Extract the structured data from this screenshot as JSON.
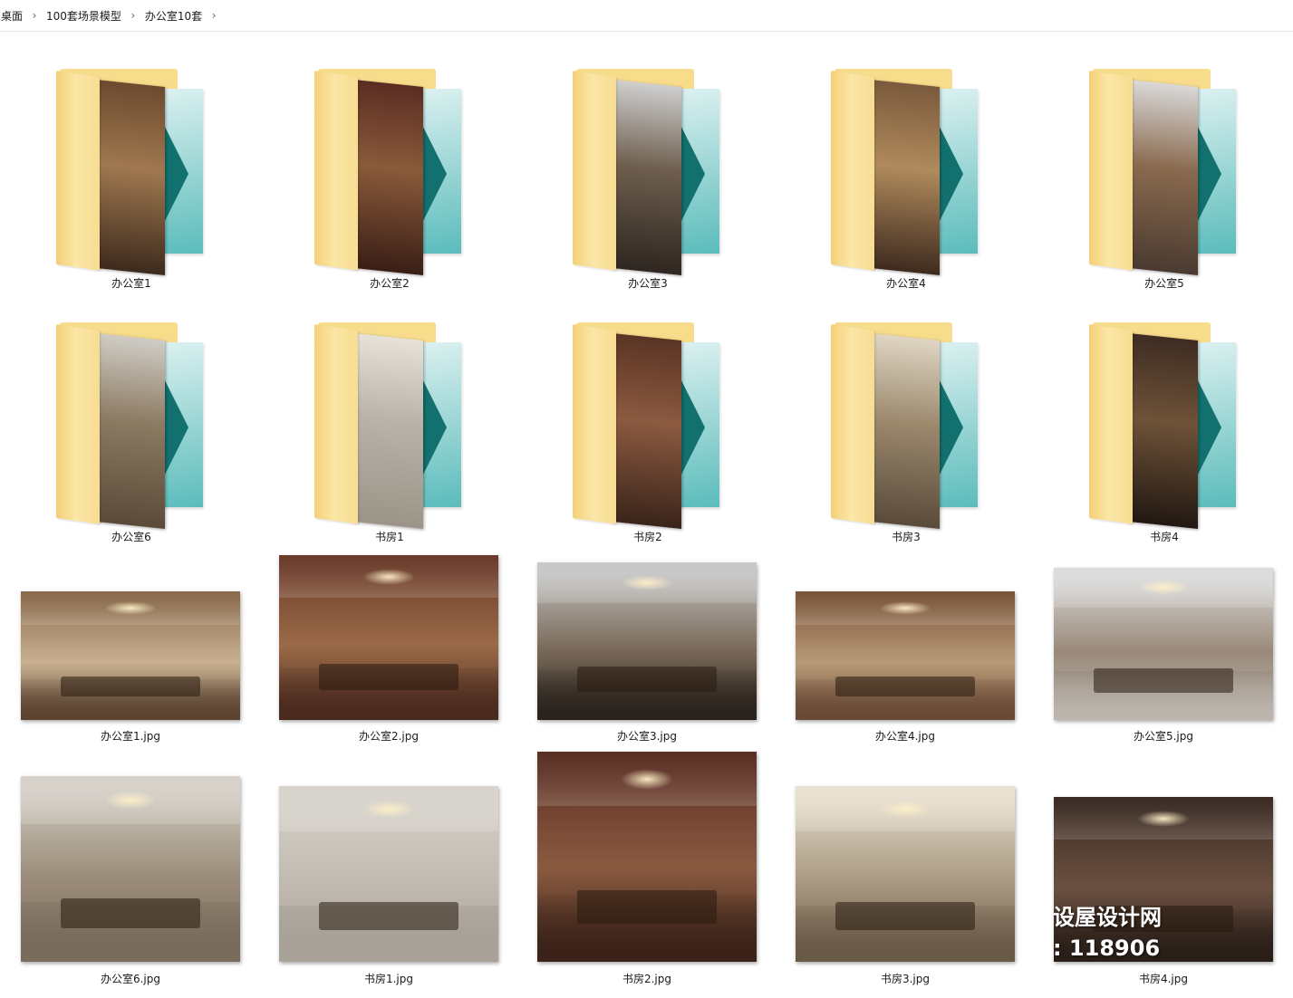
{
  "breadcrumb": {
    "items": [
      "桌面",
      "100套场景模型",
      "办公室10套"
    ]
  },
  "folders": [
    {
      "name": "办公室1",
      "palette": [
        "#6b4a2e",
        "#a07850",
        "#3d2a1c"
      ]
    },
    {
      "name": "办公室2",
      "palette": [
        "#5a2d22",
        "#8a5a3a",
        "#3a1e16"
      ]
    },
    {
      "name": "办公室3",
      "palette": [
        "#cfcfcf",
        "#6e5e4e",
        "#2e2620"
      ]
    },
    {
      "name": "办公室4",
      "palette": [
        "#7a5a3c",
        "#b08a5c",
        "#3e2a1e"
      ]
    },
    {
      "name": "办公室5",
      "palette": [
        "#d9d9d9",
        "#8a6a4e",
        "#4a3a30"
      ]
    },
    {
      "name": "办公室6",
      "palette": [
        "#d0cdc6",
        "#8c7a62",
        "#5a4a38"
      ]
    },
    {
      "name": "书房1",
      "palette": [
        "#e6e2da",
        "#b8b2a8",
        "#9c9488"
      ]
    },
    {
      "name": "书房2",
      "palette": [
        "#5a3424",
        "#8c5a40",
        "#3a241a"
      ]
    },
    {
      "name": "书房3",
      "palette": [
        "#e0d6c4",
        "#9c8a6e",
        "#5a4a3a"
      ]
    },
    {
      "name": "书房4",
      "palette": [
        "#3e2c22",
        "#6e5238",
        "#221812"
      ]
    }
  ],
  "images": [
    {
      "name": "办公室1.jpg",
      "palette": [
        "#8a6a4a",
        "#c8b090",
        "#5c4430"
      ]
    },
    {
      "name": "办公室2.jpg",
      "palette": [
        "#6a3a28",
        "#9a6a48",
        "#4a2a1e"
      ]
    },
    {
      "name": "办公室3.jpg",
      "palette": [
        "#c8c8c8",
        "#7a6a5a",
        "#2a221c"
      ]
    },
    {
      "name": "办公室4.jpg",
      "palette": [
        "#7a5438",
        "#b89a78",
        "#6a4a34"
      ]
    },
    {
      "name": "办公室5.jpg",
      "palette": [
        "#dcdcdc",
        "#9a8a7a",
        "#bdb6ae"
      ]
    },
    {
      "name": "办公室6.jpg",
      "palette": [
        "#d6d2ca",
        "#9a8c78",
        "#7a6c5c"
      ]
    },
    {
      "name": "书房1.jpg",
      "palette": [
        "#d8d4cc",
        "#c0bab0",
        "#a8a298"
      ]
    },
    {
      "name": "书房2.jpg",
      "palette": [
        "#5a2e22",
        "#8a5a40",
        "#3a2218"
      ]
    },
    {
      "name": "书房3.jpg",
      "palette": [
        "#e8e0d0",
        "#a89880",
        "#6a5a48"
      ]
    },
    {
      "name": "书房4.jpg",
      "palette": [
        "#3a2a22",
        "#6a5040",
        "#2a1e18"
      ]
    }
  ],
  "watermark": {
    "line1": "设屋设计网",
    "line2": ": 118906"
  }
}
